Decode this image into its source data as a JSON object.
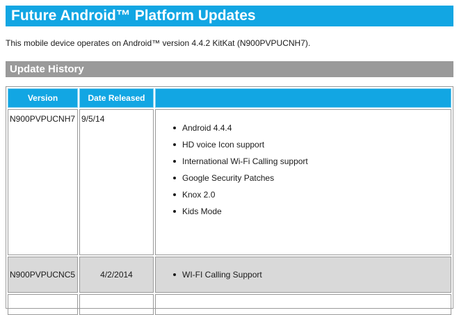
{
  "header": {
    "title": "Future Android™ Platform Updates"
  },
  "intro": {
    "text": "This mobile device operates on Android™ version 4.4.2 KitKat (N900PVPUCNH7)."
  },
  "history": {
    "title": "Update History",
    "columns": [
      "Version",
      "Date Released",
      ""
    ],
    "rows": [
      {
        "version": "N900PVPUCNH7",
        "date": "9/5/14",
        "notes": [
          "Android 4.4.4",
          "HD voice Icon support",
          "International Wi-Fi Calling support",
          "Google Security Patches",
          "Knox 2.0",
          "Kids Mode"
        ]
      },
      {
        "version": "N900PVPUCNC5",
        "date": "4/2/2014",
        "notes": [
          "WI-FI Calling Support"
        ]
      }
    ]
  }
}
